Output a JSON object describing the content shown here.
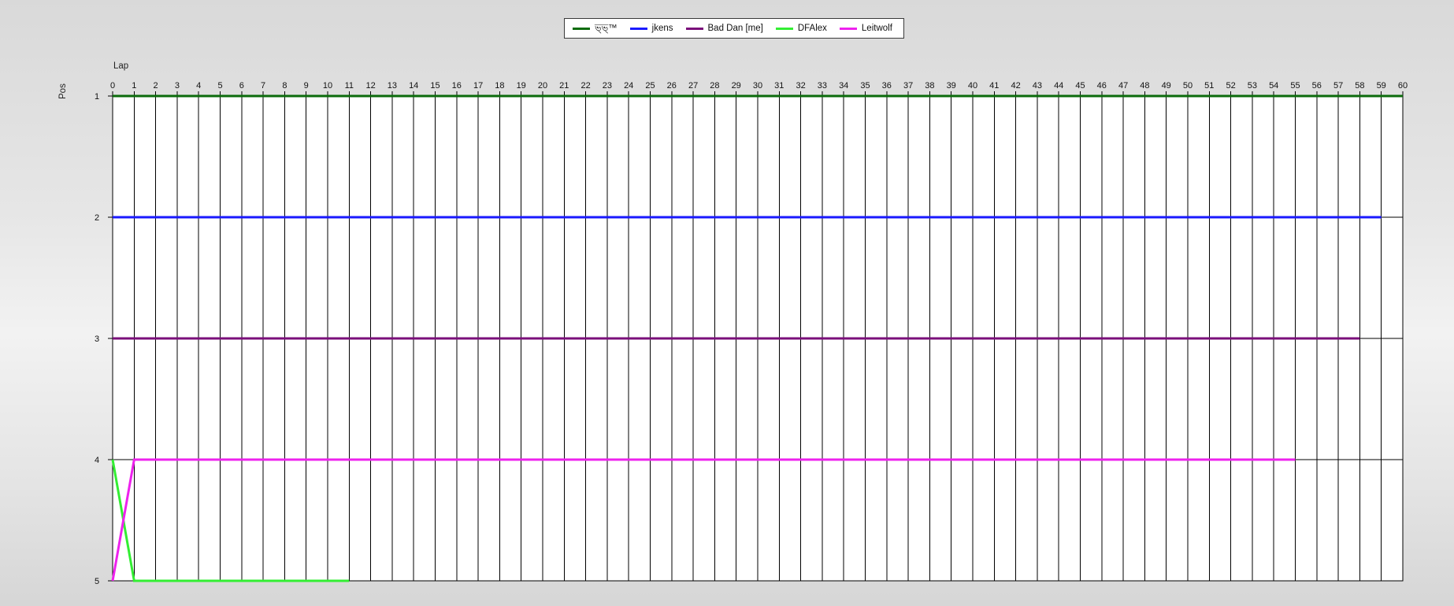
{
  "chart_data": {
    "type": "line",
    "title": "",
    "xlabel": "Lap",
    "ylabel": "Pos",
    "x_ticks": [
      0,
      1,
      2,
      3,
      4,
      5,
      6,
      7,
      8,
      9,
      10,
      11,
      12,
      13,
      14,
      15,
      16,
      17,
      18,
      19,
      20,
      21,
      22,
      23,
      24,
      25,
      26,
      27,
      28,
      29,
      30,
      31,
      32,
      33,
      34,
      35,
      36,
      37,
      38,
      39,
      40,
      41,
      42,
      43,
      44,
      45,
      46,
      47,
      48,
      49,
      50,
      51,
      52,
      53,
      54,
      55,
      56,
      57,
      58,
      59,
      60
    ],
    "y_ticks": [
      1,
      2,
      3,
      4,
      5
    ],
    "xlim": [
      0,
      60
    ],
    "ylim": [
      1,
      5
    ],
    "y_inverted": true,
    "grid": true,
    "legend_position": "top-center",
    "series": [
      {
        "name": "ভ্ভ্™",
        "color": "#0b6b0b",
        "points": [
          [
            0,
            1
          ],
          [
            60,
            1
          ]
        ]
      },
      {
        "name": "jkens",
        "color": "#1a1aff",
        "points": [
          [
            0,
            2
          ],
          [
            59,
            2
          ]
        ]
      },
      {
        "name": "Bad Dan [me]",
        "color": "#7a0f7a",
        "points": [
          [
            0,
            3
          ],
          [
            58,
            3
          ]
        ]
      },
      {
        "name": "DFAlex",
        "color": "#33ee33",
        "points": [
          [
            0,
            4
          ],
          [
            1,
            5
          ],
          [
            11,
            5
          ]
        ]
      },
      {
        "name": "Leitwolf",
        "color": "#ee22ee",
        "points": [
          [
            0,
            5
          ],
          [
            1,
            4
          ],
          [
            55,
            4
          ]
        ]
      }
    ]
  }
}
